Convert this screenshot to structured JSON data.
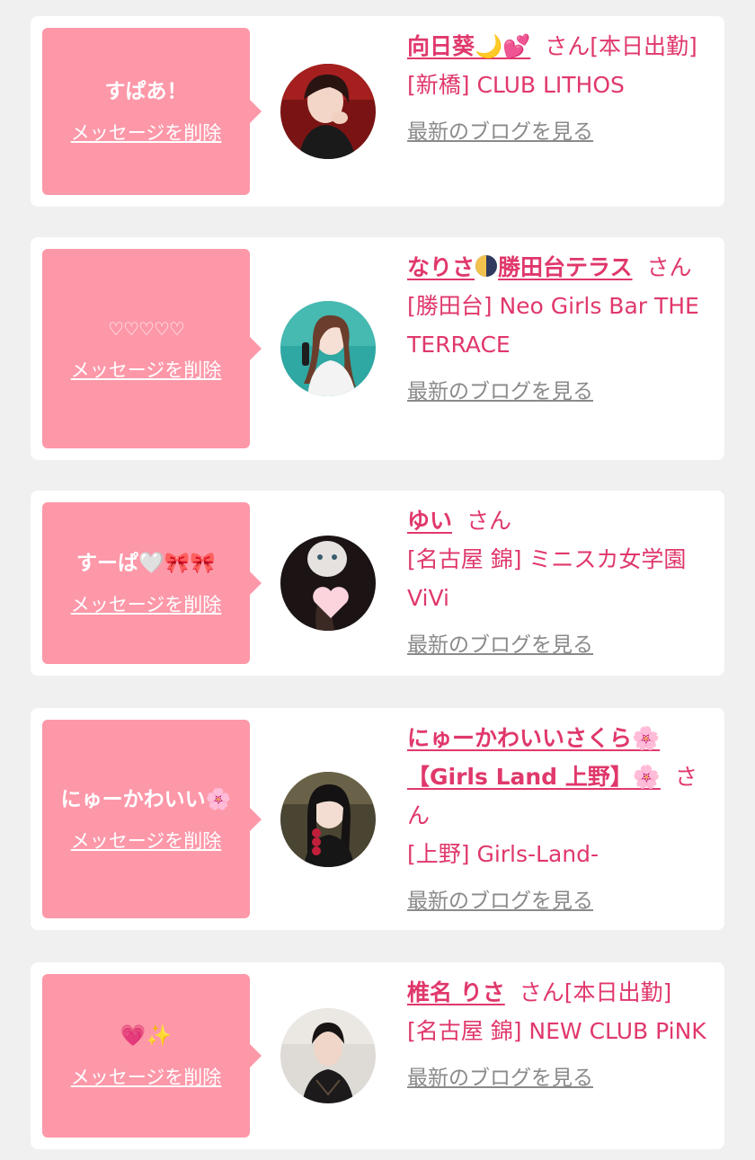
{
  "delete_label": "メッセージを削除",
  "blog_label": "最新のブログを見る",
  "san_label": "さん",
  "colors": {
    "accent": "#e0386b",
    "bubble": "#fd98a9",
    "link_gray": "#8a8a8a",
    "background": "#f0f0f0"
  },
  "cards": [
    {
      "message": "すぱあ！",
      "name": "向日葵🌙💕",
      "status": "[本日出勤]",
      "shop": "[新橋] CLUB LITHOS"
    },
    {
      "message": "♡♡♡♡♡",
      "name_before": "なりさ",
      "name_icon": "half-moon-icon",
      "name_after": "勝田台テラス",
      "status": "",
      "shop": "[勝田台] Neo Girls Bar THE TERRACE"
    },
    {
      "message": "すーぱ🤍🎀🎀",
      "name": "ゆい",
      "status": "",
      "shop": "[名古屋 錦] ミニスカ女学園ViVi"
    },
    {
      "message": "にゅーかわいい🌸",
      "name": "にゅーかわいいさくら🌸【Girls Land 上野】🌸",
      "status": "",
      "shop": "[上野] Girls-Land-"
    },
    {
      "message": "💗✨",
      "name": "椎名 りさ",
      "status": "[本日出勤]",
      "shop": "[名古屋 錦] NEW CLUB PiNK"
    }
  ]
}
